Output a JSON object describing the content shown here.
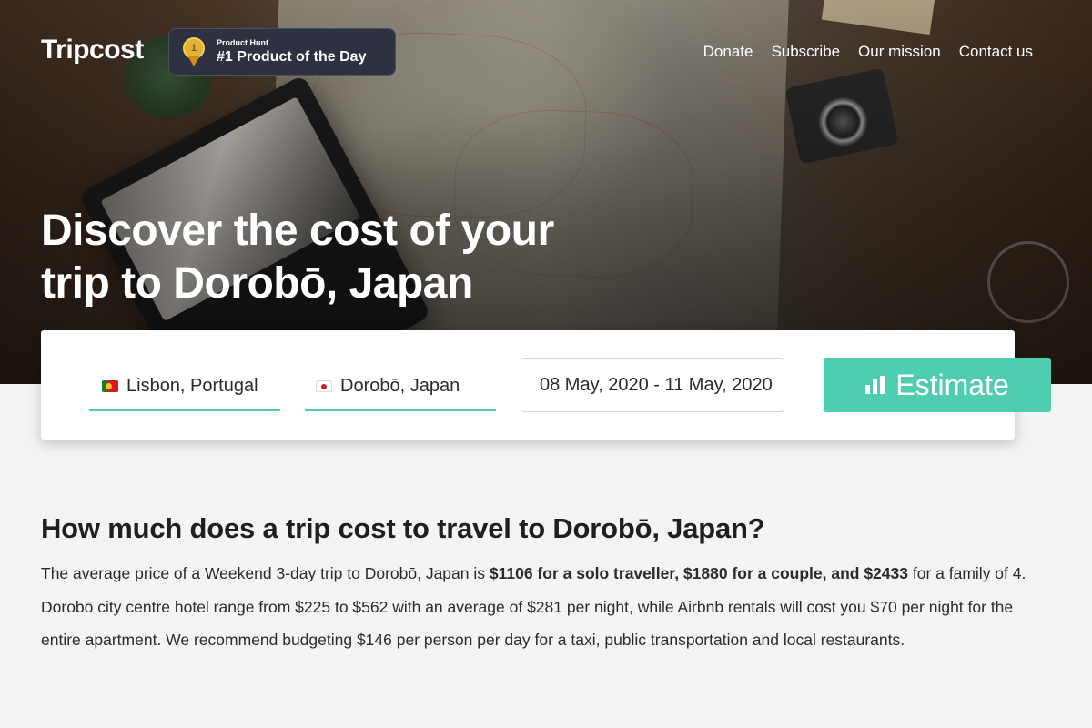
{
  "header": {
    "logo": "Tripcost",
    "badge": {
      "medal": "1",
      "small": "Product Hunt",
      "big": "#1 Product of the Day"
    },
    "nav": [
      "Donate",
      "Subscribe",
      "Our mission",
      "Contact us"
    ]
  },
  "hero": {
    "line1": "Discover the cost of your",
    "line2": "trip to Dorobō, Japan"
  },
  "search": {
    "origin": "Lisbon, Portugal",
    "destination": "Dorobō, Japan",
    "dates": "08 May, 2020 - 11 May, 2020",
    "button": "Estimate",
    "origin_flag": "portugal-flag",
    "destination_flag": "japan-flag"
  },
  "content": {
    "title": "How much does a trip cost to travel to Dorobō, Japan?",
    "p1": "The average price of a Weekend 3-day trip to Dorobō, Japan is ",
    "p_bold": "$1106 for a solo traveller, $1880 for a couple, and $2433",
    "p2": " for a family of 4. Dorobō city centre hotel range from $225 to $562 with an average of $281 per night, while Airbnb rentals will cost you $70 per night for the entire apartment. We recommend budgeting $146 per person per day for a taxi, public transportation and local restaurants."
  },
  "colors": {
    "accent": "#4ecdb0",
    "badge_bg": "#2e3140"
  }
}
